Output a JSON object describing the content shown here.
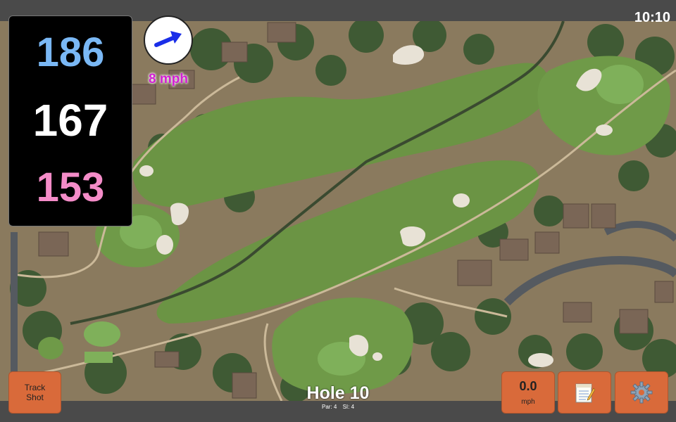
{
  "status_bar": {
    "time": "10:10"
  },
  "distances": {
    "back": "186",
    "middle": "167",
    "front": "153",
    "colors": {
      "back": "#7ab8f5",
      "middle": "#ffffff",
      "front": "#f48cc8"
    }
  },
  "wind": {
    "speed_label": "8 mph",
    "direction_icon": "arrow-icon"
  },
  "buttons": {
    "track_shot_line1": "Track",
    "track_shot_line2": "Shot",
    "speed_value": "0.0",
    "speed_unit": "mph",
    "notes_icon": "notepad-icon",
    "settings_icon": "gear-icon",
    "accent_color": "#d96a3a"
  },
  "hole": {
    "title": "Hole 10",
    "par": "Par: 4",
    "si": "SI: 4"
  },
  "map": {
    "description_icon": "satellite-course-map"
  }
}
